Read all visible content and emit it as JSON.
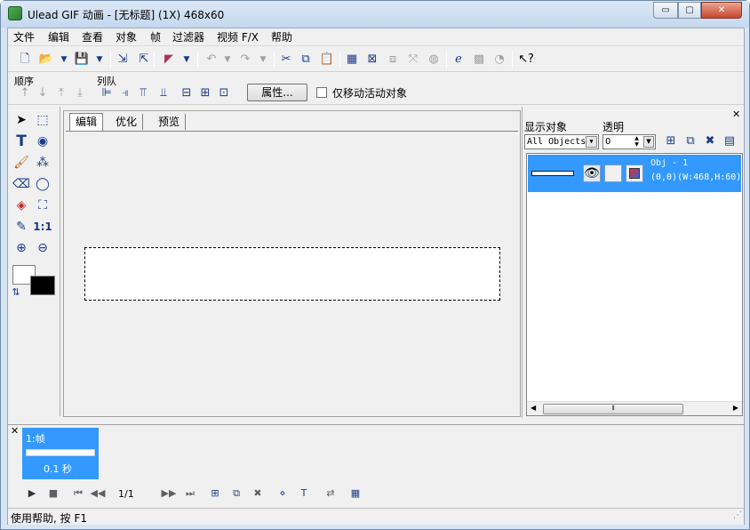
{
  "window": {
    "title": "Ulead GIF 动画 - [无标题] (1X) 468x60",
    "min_label": "▭",
    "max_label": "▢",
    "close_label": "✕"
  },
  "menu": {
    "items": [
      "文件",
      "编辑",
      "查看",
      "对象",
      "帧",
      "过滤器",
      "视频 F/X",
      "帮助"
    ]
  },
  "toolbar2": {
    "order_label": "顺序",
    "align_label": "列队",
    "attr_button": "属性...",
    "move_only_label": "仅移动活动对象"
  },
  "editor": {
    "tabs": [
      "编辑",
      "优化",
      "预览"
    ]
  },
  "objects": {
    "show_label": "显示对象",
    "trans_label": "透明",
    "filter_value": "All Objects",
    "trans_value": "0",
    "obj_name": "Obj - 1",
    "obj_info": "(0,0)(W:468,H:60)"
  },
  "frames": {
    "frame_label": "1:帧",
    "frame_delay": "0.1 秒",
    "counter": "1/1"
  },
  "status": {
    "text": "使用帮助, 按 F1"
  },
  "colors": {
    "selection": "#3399ff",
    "titlebar": "#dbe8f6",
    "close_button": "#c7462b"
  }
}
